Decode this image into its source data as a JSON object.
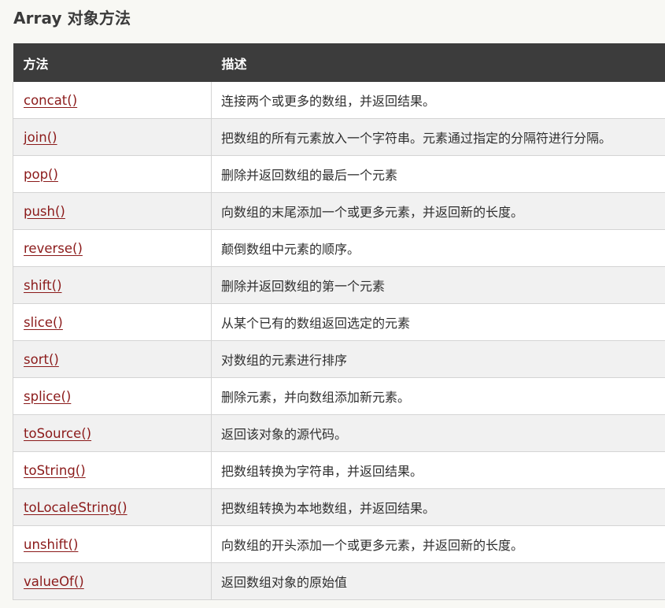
{
  "page": {
    "title": "Array 对象方法"
  },
  "table": {
    "headers": [
      "方法",
      "描述"
    ],
    "rows": [
      {
        "method": "concat()",
        "desc": "连接两个或更多的数组，并返回结果。"
      },
      {
        "method": "join()",
        "desc": "把数组的所有元素放入一个字符串。元素通过指定的分隔符进行分隔。"
      },
      {
        "method": "pop()",
        "desc": "删除并返回数组的最后一个元素"
      },
      {
        "method": "push()",
        "desc": "向数组的末尾添加一个或更多元素，并返回新的长度。"
      },
      {
        "method": "reverse()",
        "desc": "颠倒数组中元素的顺序。"
      },
      {
        "method": "shift()",
        "desc": "删除并返回数组的第一个元素"
      },
      {
        "method": "slice()",
        "desc": "从某个已有的数组返回选定的元素"
      },
      {
        "method": "sort()",
        "desc": "对数组的元素进行排序"
      },
      {
        "method": "splice()",
        "desc": "删除元素，并向数组添加新元素。"
      },
      {
        "method": "toSource()",
        "desc": "返回该对象的源代码。"
      },
      {
        "method": "toString()",
        "desc": "把数组转换为字符串，并返回结果。"
      },
      {
        "method": "toLocaleString()",
        "desc": "把数组转换为本地数组，并返回结果。"
      },
      {
        "method": "unshift()",
        "desc": "向数组的开头添加一个或更多元素，并返回新的长度。"
      },
      {
        "method": "valueOf()",
        "desc": "返回数组对象的原始值"
      }
    ]
  },
  "colors": {
    "header_bg": "#3c3c3c",
    "link": "#8b1a1a",
    "row_alt": "#f1f1f1",
    "page_bg": "#f8f8f4"
  }
}
